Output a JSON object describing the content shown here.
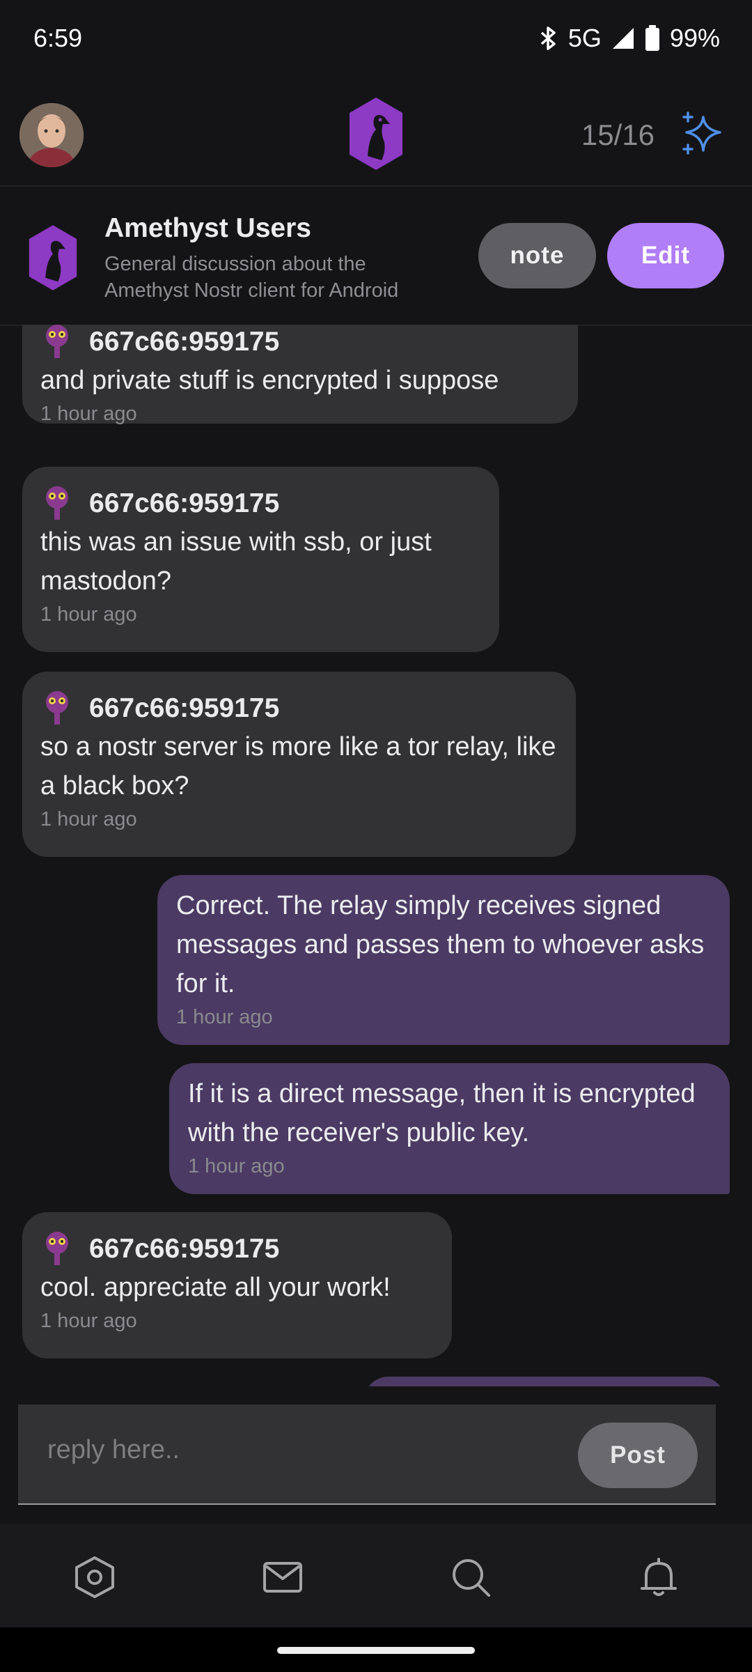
{
  "status": {
    "time": "6:59",
    "network": "5G",
    "battery": "99%"
  },
  "header": {
    "counter": "15/16"
  },
  "channel": {
    "title": "Amethyst Users",
    "description": "General discussion about the Amethyst Nostr client for Android",
    "note_label": "note",
    "edit_label": "Edit"
  },
  "messages": [
    {
      "author": "667c66:959175",
      "text": "and private stuff is encrypted i suppose",
      "time": "1 hour ago"
    },
    {
      "author": "667c66:959175",
      "text": "this was an issue with ssb, or just mastodon?",
      "time": "1 hour ago"
    },
    {
      "author": "667c66:959175",
      "text": "so a nostr server is more like a tor relay, like a black box?",
      "time": "1 hour ago"
    },
    {
      "text": "Correct. The relay simply receives signed messages and passes them to whoever asks for it.",
      "time": "1 hour ago"
    },
    {
      "text": "If it is a direct message, then it is encrypted with the receiver's public key.",
      "time": "1 hour ago"
    },
    {
      "author": "667c66:959175",
      "text": "cool. appreciate all your work!",
      "time": "1 hour ago"
    }
  ],
  "composer": {
    "placeholder": "reply here..",
    "post_label": "Post"
  },
  "colors": {
    "accent": "#b07ef6",
    "outgoing_bubble": "#4b3a63",
    "incoming_bubble": "#323234",
    "background": "#141416"
  }
}
